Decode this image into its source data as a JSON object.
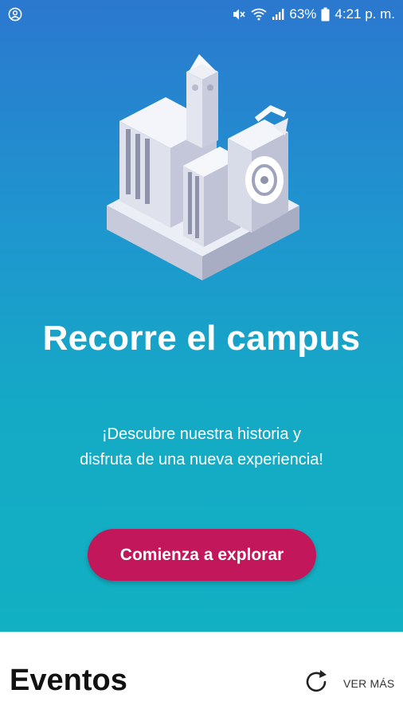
{
  "status_bar": {
    "battery_percent": "63%",
    "time": "4:21 p. m.",
    "icons": [
      "account-circle-icon",
      "mute-icon",
      "wifi-icon",
      "signal-icon",
      "battery-icon"
    ]
  },
  "hero": {
    "illustration": "campus-building-illustration",
    "title": "Recorre el campus",
    "subtitle_line1": "¡Descubre nuestra historia y",
    "subtitle_line2": "disfruta de una nueva experiencia!",
    "cta_label": "Comienza a explorar",
    "colors": {
      "gradient_top": "#2b78cf",
      "gradient_bottom": "#12b0c3",
      "cta": "#c2185b"
    }
  },
  "events": {
    "title": "Eventos",
    "see_more_label": "VER MÁS",
    "refresh_icon": "refresh-icon"
  }
}
